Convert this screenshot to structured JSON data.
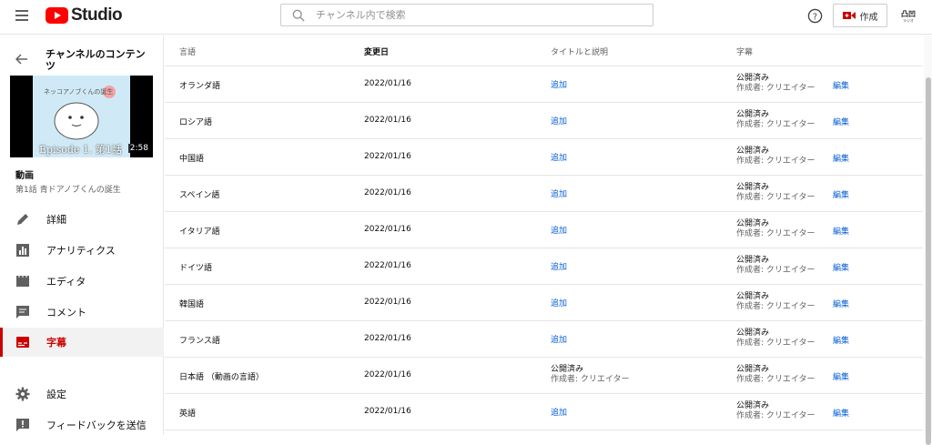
{
  "header": {
    "logo_text": "Studio",
    "search_placeholder": "チャンネル内で検索",
    "create_label": "作成",
    "channel_icon_text": "凸凹",
    "channel_icon_sub": "ラジオ"
  },
  "sidebar": {
    "back_title": "チャンネルのコンテンツ",
    "thumbnail_caption": "Episode 1.  第1話",
    "thumbnail_duration": "2:58",
    "thumbnail_handwriting": "ネッコアノブくんの誕生",
    "video_label": "動画",
    "video_title": "第1話 青ドアノブくんの誕生",
    "items": [
      {
        "label": "詳細",
        "icon": "pencil-icon"
      },
      {
        "label": "アナリティクス",
        "icon": "analytics-icon"
      },
      {
        "label": "エディタ",
        "icon": "editor-icon"
      },
      {
        "label": "コメント",
        "icon": "comment-icon"
      },
      {
        "label": "字幕",
        "icon": "subtitles-icon"
      },
      {
        "label": "設定",
        "icon": "gear-icon"
      },
      {
        "label": "フィードバックを送信",
        "icon": "feedback-icon"
      }
    ]
  },
  "table": {
    "headers": {
      "language": "言語",
      "modified": "変更日",
      "title_desc": "タイトルと説明",
      "subtitles": "字幕"
    },
    "rows": [
      {
        "language": "オランダ語",
        "date": "2022/01/16",
        "title_desc": "追加",
        "sub_status": "公開済み",
        "sub_author": "作成者: クリエイター",
        "edit": "編集"
      },
      {
        "language": "ロシア語",
        "date": "2022/01/16",
        "title_desc": "追加",
        "sub_status": "公開済み",
        "sub_author": "作成者: クリエイター",
        "edit": "編集"
      },
      {
        "language": "中国語",
        "date": "2022/01/16",
        "title_desc": "追加",
        "sub_status": "公開済み",
        "sub_author": "作成者: クリエイター",
        "edit": "編集"
      },
      {
        "language": "スペイン語",
        "date": "2022/01/16",
        "title_desc": "追加",
        "sub_status": "公開済み",
        "sub_author": "作成者: クリエイター",
        "edit": "編集"
      },
      {
        "language": "イタリア語",
        "date": "2022/01/16",
        "title_desc": "追加",
        "sub_status": "公開済み",
        "sub_author": "作成者: クリエイター",
        "edit": "編集"
      },
      {
        "language": "ドイツ語",
        "date": "2022/01/16",
        "title_desc": "追加",
        "sub_status": "公開済み",
        "sub_author": "作成者: クリエイター",
        "edit": "編集"
      },
      {
        "language": "韓国語",
        "date": "2022/01/16",
        "title_desc": "追加",
        "sub_status": "公開済み",
        "sub_author": "作成者: クリエイター",
        "edit": "編集"
      },
      {
        "language": "フランス語",
        "date": "2022/01/16",
        "title_desc": "追加",
        "sub_status": "公開済み",
        "sub_author": "作成者: クリエイター",
        "edit": "編集"
      },
      {
        "language": "日本語 （動画の言語）",
        "date": "2022/01/16",
        "title_desc": "公開済み",
        "title_desc_author": "作成者: クリエイター",
        "sub_status": "公開済み",
        "sub_author": "作成者: クリエイター",
        "edit": "編集"
      },
      {
        "language": "英語",
        "date": "2022/01/16",
        "title_desc": "追加",
        "sub_status": "公開済み",
        "sub_author": "作成者: クリエイター",
        "edit": "編集"
      }
    ]
  },
  "colors": {
    "brand_red": "#ff0000",
    "active_red": "#cc0000",
    "link_blue": "#065fd4"
  }
}
